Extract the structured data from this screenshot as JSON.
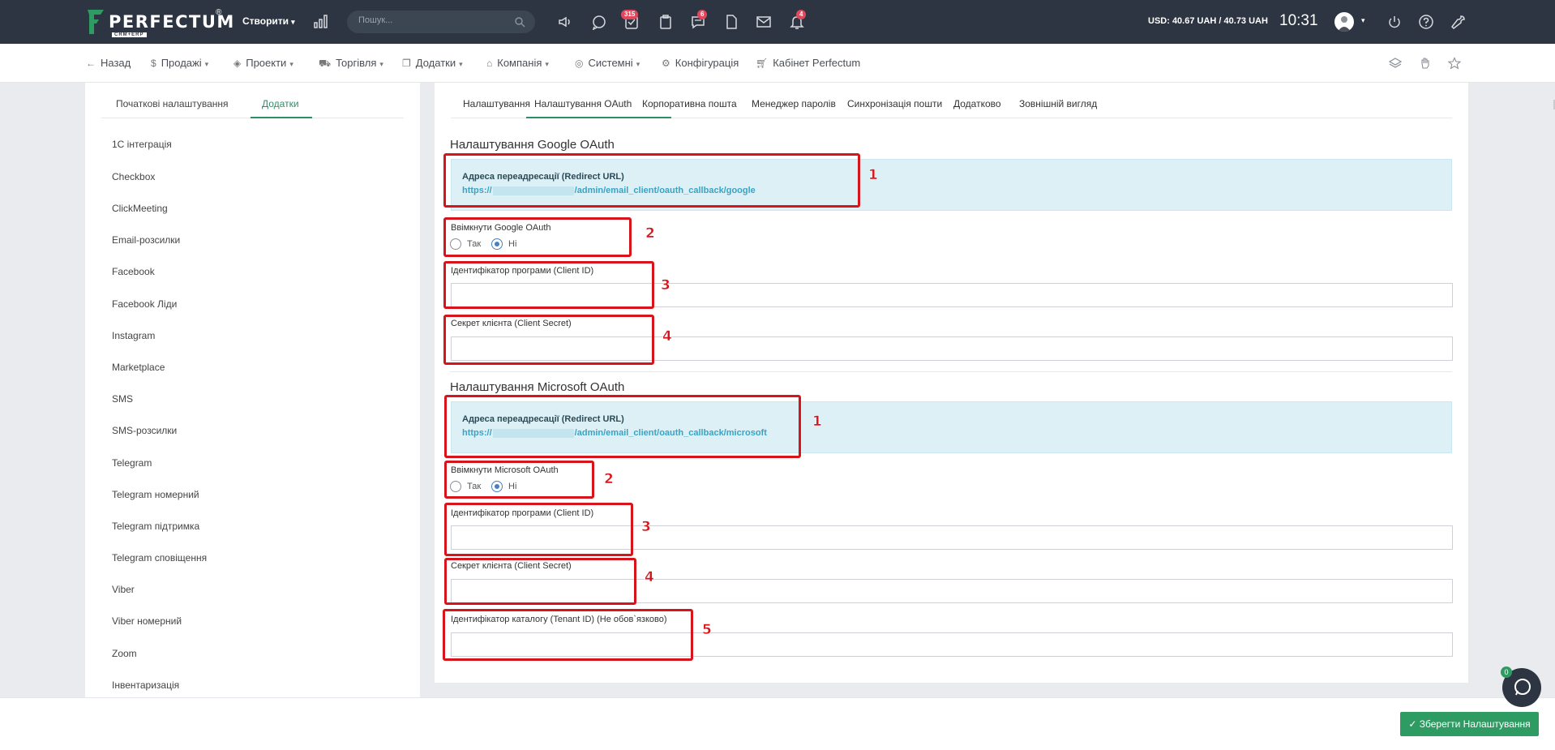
{
  "topbar": {
    "logo_text": "PERFECTUM",
    "logo_sub": "CRM+ERP",
    "logo_reg": "®",
    "create_label": "Створити",
    "search_placeholder": "Пошук...",
    "badges": {
      "tasks": "315",
      "messages": "6",
      "notifications": "4"
    },
    "currency": "USD: 40.67 UAH / 40.73 UAH",
    "time": "10:31"
  },
  "nav": {
    "back": "Назад",
    "sales": "Продажі",
    "projects": "Проекти",
    "trade": "Торгівля",
    "addons": "Додатки",
    "company": "Компанія",
    "system": "Системні",
    "config": "Конфігурація",
    "cabinet": "Кабінет Perfectum"
  },
  "left": {
    "tabs": [
      "Початкові налаштування",
      "Додатки"
    ],
    "active_tab": "Додатки",
    "items": [
      "1С інтеграція",
      "Checkbox",
      "ClickMeeting",
      "Email-розсилки",
      "Facebook",
      "Facebook Ліди",
      "Instagram",
      "Marketplace",
      "SMS",
      "SMS-розсилки",
      "Telegram",
      "Telegram номерний",
      "Telegram підтримка",
      "Telegram сповіщення",
      "Viber",
      "Viber номерний",
      "Zoom",
      "Інвентаризація"
    ]
  },
  "main": {
    "tabs": [
      "Налаштування",
      "Налаштування OAuth",
      "Корпоративна пошта",
      "Менеджер паролів",
      "Синхронізація пошти",
      "Додатково",
      "Зовнішній вигляд"
    ],
    "active_tab": "Налаштування OAuth",
    "google": {
      "title": "Налаштування Google OAuth",
      "redirect_label": "Адреса переадресації (Redirect URL)",
      "url_prefix": "https://",
      "url_suffix": "/admin/email_client/oauth_callback/google",
      "enable_label": "Ввімкнути Google OAuth",
      "yes": "Так",
      "no": "Ні",
      "enabled": "no",
      "client_id_label": "Ідентифікатор програми (Client ID)",
      "client_id_value": "",
      "client_secret_label": "Секрет клієнта (Client Secret)",
      "client_secret_value": ""
    },
    "microsoft": {
      "title": "Налаштування Microsoft OAuth",
      "redirect_label": "Адреса переадресації (Redirect URL)",
      "url_prefix": "https://",
      "url_suffix": "/admin/email_client/oauth_callback/microsoft",
      "enable_label": "Ввімкнути Microsoft OAuth",
      "yes": "Так",
      "no": "Ні",
      "enabled": "no",
      "client_id_label": "Ідентифікатор програми (Client ID)",
      "client_id_value": "",
      "client_secret_label": "Секрет клієнта (Client Secret)",
      "client_secret_value": "",
      "tenant_label": "Ідентифікатор каталогу (Tenant ID) (Не обов`язково)",
      "tenant_value": ""
    }
  },
  "annotations": [
    "1",
    "2",
    "3",
    "4",
    "1",
    "2",
    "3",
    "4",
    "5"
  ],
  "footer": {
    "save_label": "✓ Зберегти Налаштування",
    "chat_badge": "0"
  },
  "colors": {
    "topbar": "#2c3541",
    "accent": "#2d8f66",
    "save": "#2e9b63",
    "badge": "#e2475d",
    "info_bg": "#dcf0f6",
    "annotation": "#d7141b"
  }
}
